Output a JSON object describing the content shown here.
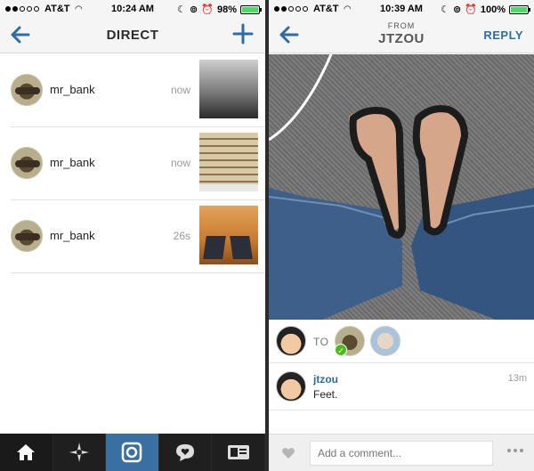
{
  "left": {
    "status": {
      "carrier": "AT&T",
      "time": "10:24 AM",
      "battery": "98%",
      "battery_fill": 0.98
    },
    "nav": {
      "title": "DIRECT"
    },
    "messages": [
      {
        "username": "mr_bank",
        "time": "now"
      },
      {
        "username": "mr_bank",
        "time": "now"
      },
      {
        "username": "mr_bank",
        "time": "26s"
      }
    ],
    "tabbar": [
      {
        "icon": "home-icon"
      },
      {
        "icon": "explore-icon"
      },
      {
        "icon": "camera-icon"
      },
      {
        "icon": "activity-icon"
      },
      {
        "icon": "profile-icon"
      }
    ]
  },
  "right": {
    "status": {
      "carrier": "AT&T",
      "time": "10:39 AM",
      "battery": "100%",
      "battery_fill": 1.0
    },
    "nav": {
      "from_label": "FROM",
      "from_name": "JTZOU",
      "reply": "REPLY"
    },
    "to_label": "TO",
    "comment": {
      "user": "jtzou",
      "text": "Feet.",
      "time": "13m"
    },
    "compose": {
      "placeholder": "Add a comment..."
    }
  },
  "colors": {
    "accent": "#2e6da4",
    "battery_green": "#4cd964",
    "camera_tab": "#3a6fa3"
  }
}
